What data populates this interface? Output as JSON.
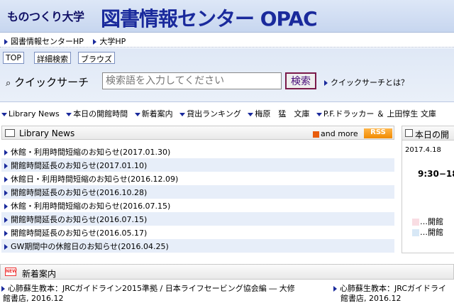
{
  "header": {
    "sub_title": "ものつくり大学",
    "title": "図書情報センター OPAC"
  },
  "top_links": [
    "図書情報センターHP",
    "大学HP"
  ],
  "tabs": [
    "TOP",
    "詳細検索",
    "ブラウズ"
  ],
  "quick_search": {
    "label": "クイックサーチ",
    "placeholder": "検索語を入力してください",
    "button": "検索",
    "help": "クイックサーチとは？"
  },
  "menu": [
    "Library News",
    "本日の開館時間",
    "新着案内",
    "貸出ランキング",
    "梅原　猛　文庫",
    "P.F.ドラッカー ＆ 上田惇生 文庫"
  ],
  "news": {
    "title": "Library News",
    "and_more": "and more",
    "rss": "RSS",
    "items": [
      "休館・利用時間短縮のお知らせ(2017.01.30)",
      "開館時間延長のお知らせ(2017.01.10)",
      "休館日・利用時間短縮のお知らせ(2016.12.09)",
      "開館時間延長のお知らせ(2016.10.28)",
      "休館・利用時間短縮のお知らせ(2016.07.15)",
      "開館時間延長のお知らせ(2016.07.15)",
      "開館時間延長のお知らせ(2016.05.17)",
      "GW期間中の休館日のお知らせ(2016.04.25)"
    ]
  },
  "calendar": {
    "title": "本日の開",
    "date": "2017.4.18",
    "hours": "9:30−18",
    "legend": [
      {
        "label": "…開館",
        "color": "#f9dde3"
      },
      {
        "label": "…開館",
        "color": "#d8e8f6"
      }
    ]
  },
  "new_arrivals": {
    "title": "新着案内",
    "badge": "NEW",
    "books": [
      {
        "line1": "心肺蘇生教本：JRCガイドライン2015準拠 / 日本ライフセービング協会編 ― 大修",
        "line2": "館書店, 2016.12"
      },
      {
        "line1": "心肺蘇生教本：JRCガイドライ",
        "line2": "館書店, 2016.12"
      }
    ]
  },
  "colors": {
    "header_title": "#1a2a9c",
    "accent_triangle": "#1a2a9c",
    "alt_row": "#e7eef9",
    "rss": "#f18a00"
  }
}
